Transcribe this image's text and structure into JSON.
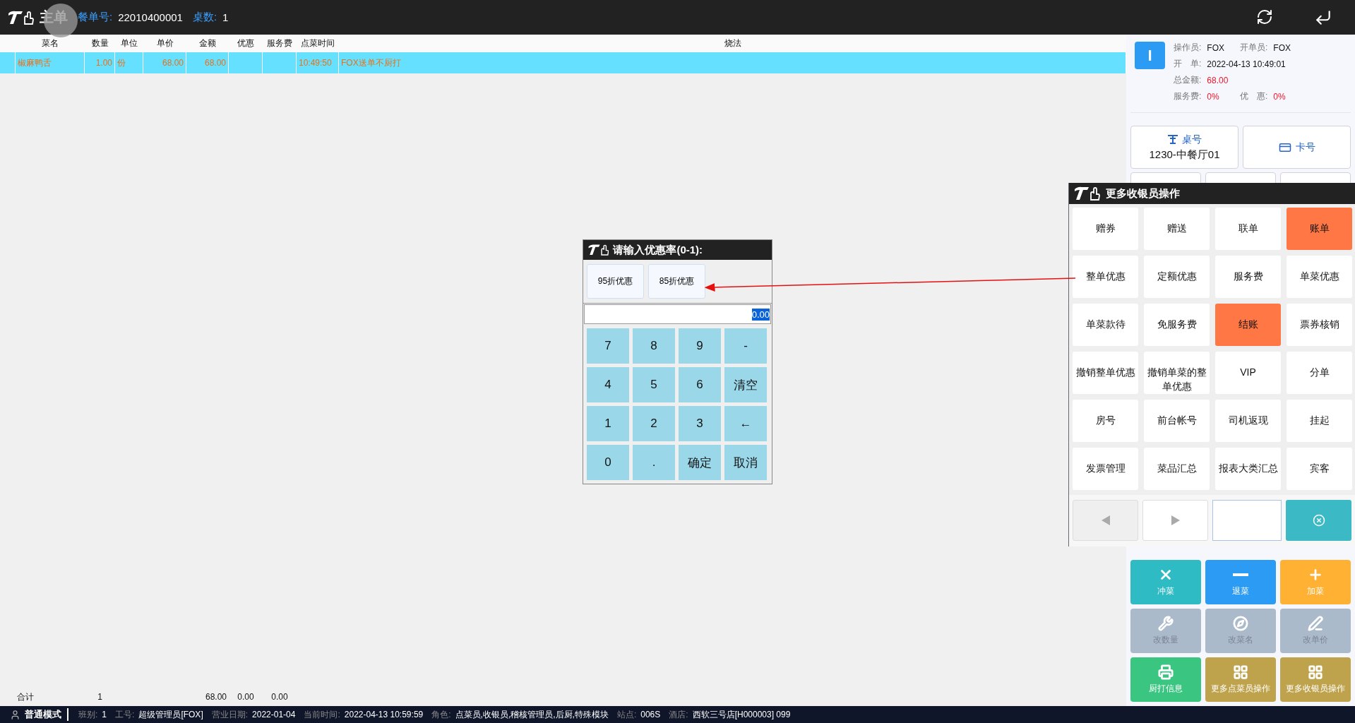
{
  "header": {
    "title": "主单",
    "order_label": "餐单号:",
    "order_no": "22010400001",
    "table_count_label": "桌数:",
    "table_count": "1"
  },
  "table": {
    "columns": [
      "",
      "菜名",
      "数量",
      "单位",
      "单价",
      "金额",
      "优惠",
      "服务费",
      "点菜时间",
      "烧法"
    ],
    "rows": [
      {
        "selected": true,
        "cells": [
          "",
          "椒麻鸭舌",
          "1.00",
          "份",
          "68.00",
          "68.00",
          "",
          "",
          "10:49:50",
          "FOX送单不厨打"
        ]
      }
    ],
    "total": {
      "label": "合计",
      "count": "1",
      "amount": "68.00",
      "discount": "0.00",
      "service": "0.00"
    }
  },
  "info": {
    "avatar": "I",
    "operator_label": "操作员:",
    "operator": "FOX",
    "opener_label": "开单员:",
    "opener": "FOX",
    "open_label": "开　单:",
    "open_time": "2022-04-13 10:49:01",
    "amount_label": "总金额:",
    "amount": "68.00",
    "service_label": "服务费:",
    "service": "0%",
    "discount_label": "优　惠:",
    "discount": "0%"
  },
  "table_button": {
    "label": "桌号",
    "value": "1230-中餐厅01"
  },
  "card_button": {
    "label": "卡号"
  },
  "actions": [
    {
      "label": "冲菜",
      "color": "#2ebbc4",
      "disabled": false
    },
    {
      "label": "退菜",
      "color": "#2b9bf4",
      "disabled": false
    },
    {
      "label": "加菜",
      "color": "#ffb134",
      "disabled": false
    },
    {
      "label": "改数量",
      "color": "#abbacb",
      "disabled": true
    },
    {
      "label": "改菜名",
      "color": "#abbacb",
      "disabled": true
    },
    {
      "label": "改单价",
      "color": "#abbacb",
      "disabled": true
    },
    {
      "label": "厨打信息",
      "color": "#3ac580",
      "disabled": false
    },
    {
      "label": "更多点菜员操作",
      "color": "#bfa34c",
      "disabled": false
    },
    {
      "label": "更多收银员操作",
      "color": "#bfa34c",
      "disabled": false
    }
  ],
  "dialog": {
    "title": "请输入优惠率(0-1):",
    "presets": [
      "95折优惠",
      "85折优惠"
    ],
    "value": "0.00",
    "keys": [
      "7",
      "8",
      "9",
      "-",
      "4",
      "5",
      "6",
      "清空",
      "1",
      "2",
      "3",
      "←",
      "0",
      ".",
      "确定",
      "取消"
    ]
  },
  "popup": {
    "title": "更多收银员操作",
    "items": [
      {
        "label": "赠券",
        "kind": "plain"
      },
      {
        "label": "赠送",
        "kind": "plain"
      },
      {
        "label": "联单",
        "kind": "plain"
      },
      {
        "label": "账单",
        "kind": "accent"
      },
      {
        "label": "整单优惠",
        "kind": "plain"
      },
      {
        "label": "定额优惠",
        "kind": "plain"
      },
      {
        "label": "服务费",
        "kind": "plain"
      },
      {
        "label": "单菜优惠",
        "kind": "plain"
      },
      {
        "label": "单菜款待",
        "kind": "plain"
      },
      {
        "label": "免服务费",
        "kind": "plain"
      },
      {
        "label": "结账",
        "kind": "accent"
      },
      {
        "label": "票券核销",
        "kind": "plain"
      },
      {
        "label": "撤销整单优惠",
        "kind": "plain"
      },
      {
        "label": "撤销单菜的整单优惠",
        "kind": "plain"
      },
      {
        "label": "VIP",
        "kind": "plain"
      },
      {
        "label": "分单",
        "kind": "plain"
      },
      {
        "label": "房号",
        "kind": "plain"
      },
      {
        "label": "前台帐号",
        "kind": "plain"
      },
      {
        "label": "司机返现",
        "kind": "plain"
      },
      {
        "label": "挂起",
        "kind": "plain"
      },
      {
        "label": "发票管理",
        "kind": "plain"
      },
      {
        "label": "菜品汇总",
        "kind": "plain"
      },
      {
        "label": "报表大类汇总",
        "kind": "plain"
      },
      {
        "label": "宾客",
        "kind": "plain"
      }
    ],
    "prev_disabled": true
  },
  "status": {
    "mode": "普通模式",
    "fields": [
      {
        "label": "班别:",
        "value": "1"
      },
      {
        "label": "工号:",
        "value": "超级管理员[FOX]"
      },
      {
        "label": "营业日期:",
        "value": "2022-01-04"
      },
      {
        "label": "当前时间:",
        "value": "2022-04-13 10:59:59"
      },
      {
        "label": "角色:",
        "value": "点菜员,收银员,稽核管理员,后厨,特殊模块"
      },
      {
        "label": "站点:",
        "value": "006S"
      },
      {
        "label": "酒店:",
        "value": "西软三号店[H000003] 099"
      }
    ]
  }
}
